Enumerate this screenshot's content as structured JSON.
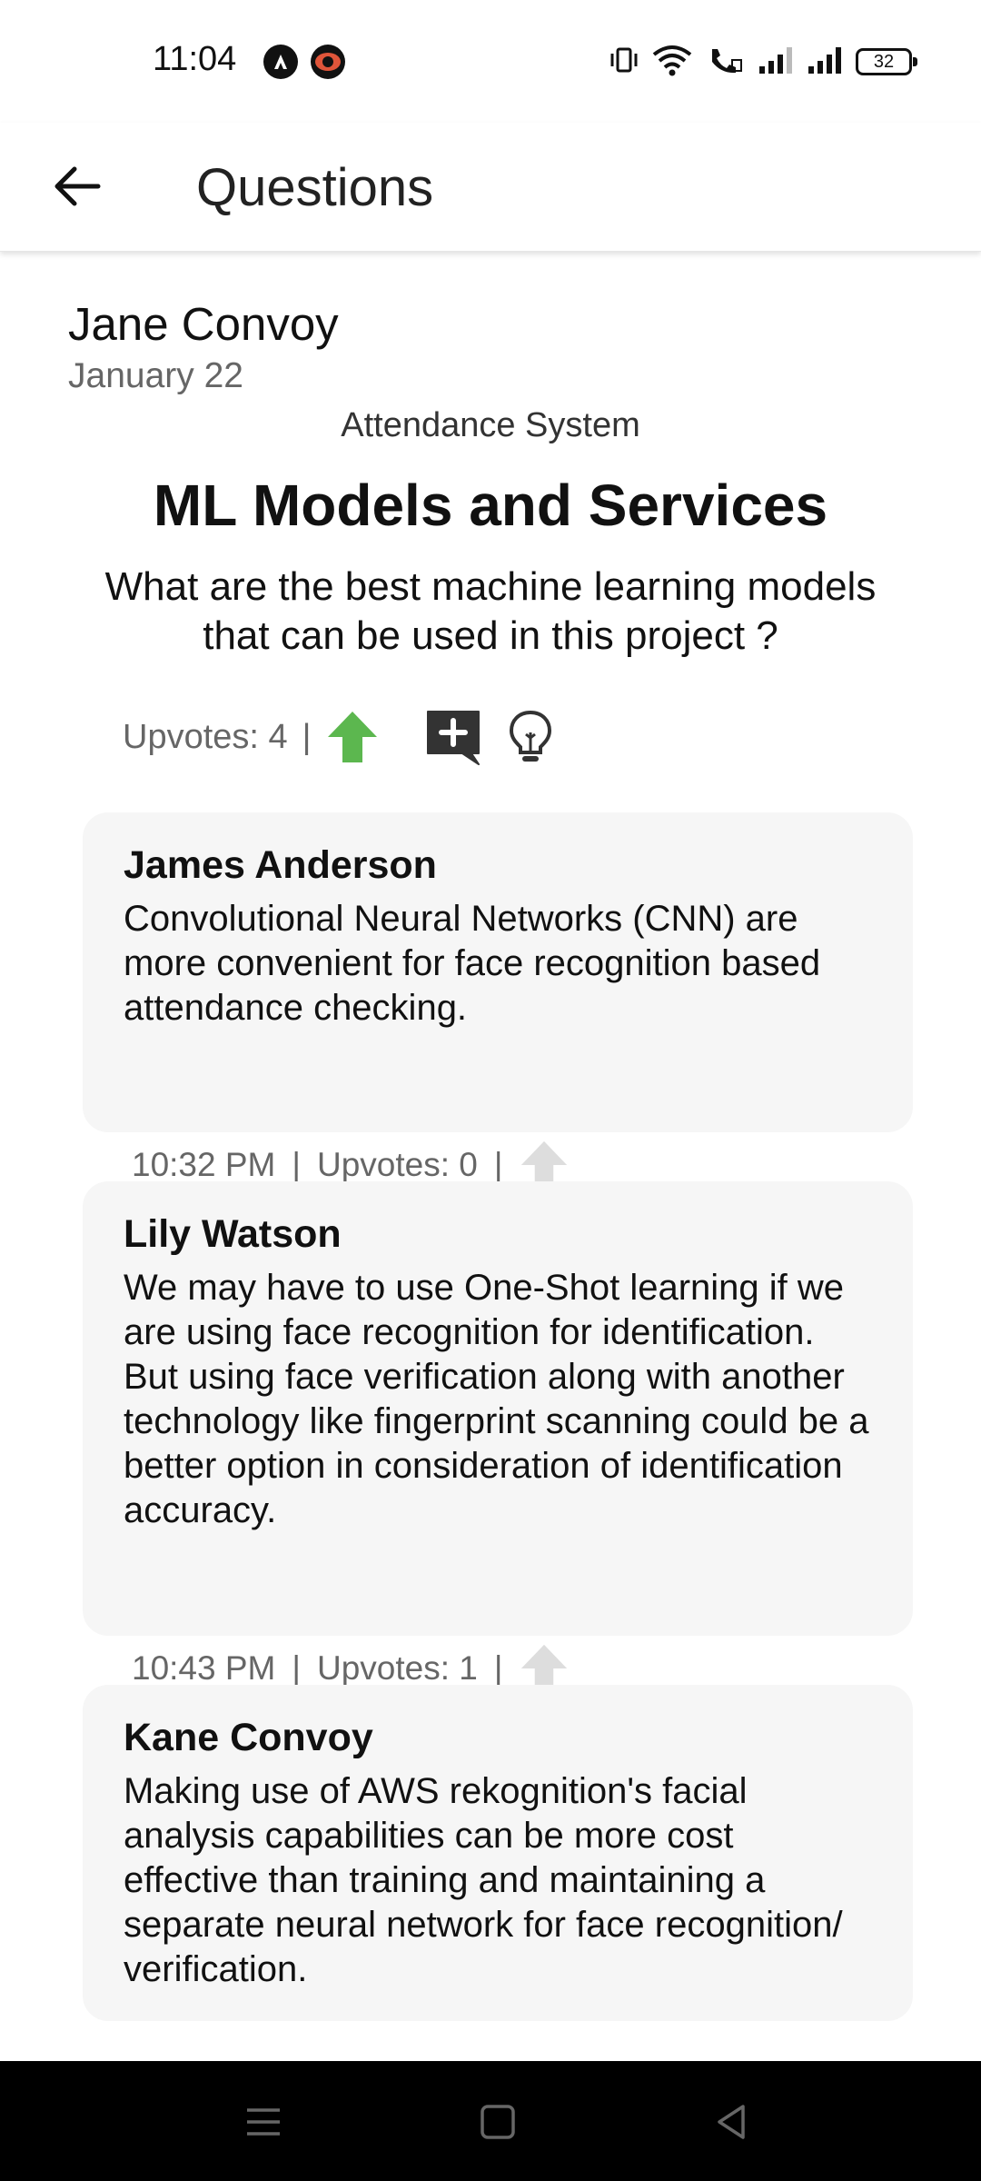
{
  "status_bar": {
    "time": "11:04",
    "battery": "32"
  },
  "app_bar": {
    "title": "Questions"
  },
  "question": {
    "author": "Jane Convoy",
    "date": "January 22",
    "project": "Attendance System",
    "title": "ML Models and Services",
    "body": "What are the best machine learning models that can be used in this project ?",
    "upvotes_label": "Upvotes: 4",
    "separator": "|",
    "upvote_active_color": "#5cb74f"
  },
  "answers": [
    {
      "author": "James Anderson",
      "text": "Convolutional Neural Networks (CNN) are more convenient for face recognition based attendance checking.",
      "time": "10:32 PM",
      "upvotes_label": "Upvotes: 0"
    },
    {
      "author": "Lily Watson",
      "text": "We may have to use One-Shot learning if we are using face recognition for identification. But using face verification along with another technology like fingerprint scanning could be a better option in consideration of identification accuracy.",
      "time": "10:43 PM",
      "upvotes_label": "Upvotes: 1"
    },
    {
      "author": "Kane Convoy",
      "text": "Making use of AWS rekognition's facial analysis capabilities can be more cost effective than training and maintaining a separate neural  network for face recognition/ verification."
    }
  ],
  "icons": {
    "back": "arrow-left-icon",
    "upvote": "arrow-up-icon",
    "add_answer": "comment-plus-icon",
    "idea": "lightbulb-icon",
    "nav_menu": "menu-icon",
    "nav_home": "home-square-icon",
    "nav_back": "back-triangle-icon"
  }
}
